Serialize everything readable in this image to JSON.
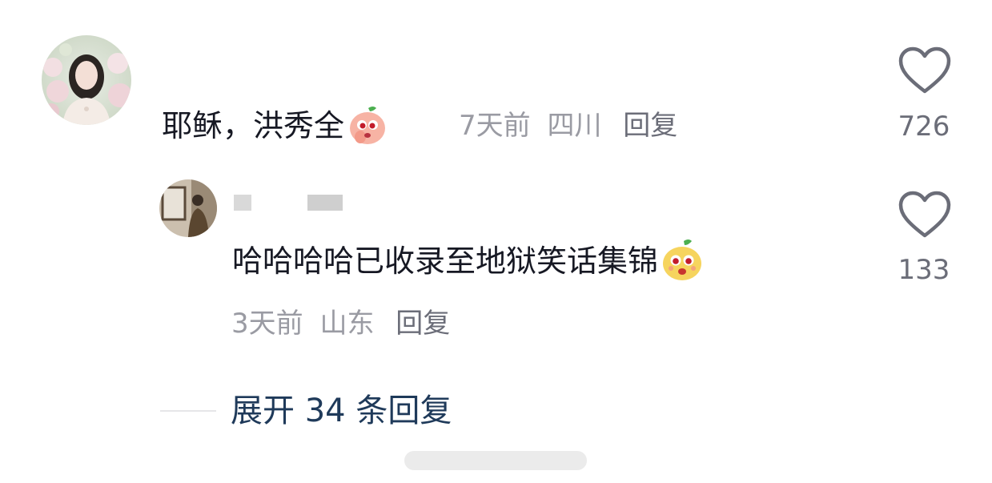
{
  "comment": {
    "text": "耶稣，洪秀全",
    "time": "7天前",
    "location": "四川",
    "reply_label": "回复",
    "like_count": "726",
    "sticker_icon": "peach-sticker-icon"
  },
  "reply": {
    "text": "哈哈哈哈已收录至地狱笑话集锦",
    "time": "3天前",
    "location": "山东",
    "reply_label": "回复",
    "like_count": "133",
    "sticker_icon": "pear-sticker-icon"
  },
  "expand": {
    "label": "展开 34 条回复"
  },
  "colors": {
    "text_primary": "#161823",
    "meta": "#9a9ba3",
    "expand_link": "#1f3a5a",
    "heart_stroke": "#6b6d78"
  }
}
